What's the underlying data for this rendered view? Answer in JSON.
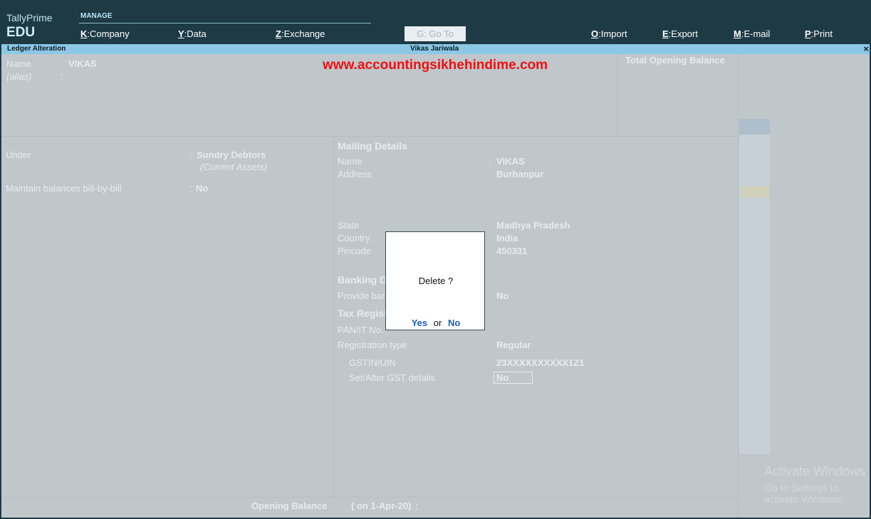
{
  "app": {
    "name": "TallyPrime",
    "edition": "EDU"
  },
  "menu": {
    "section_label": "MANAGE",
    "company": {
      "key": "K",
      "label": ":Company"
    },
    "data": {
      "key": "Y",
      "label": ":Data"
    },
    "exchange": {
      "key": "Z",
      "label": ":Exchange"
    },
    "goto": "G: Go To",
    "import": {
      "key": "O",
      "label": ":Import"
    },
    "export": {
      "key": "E",
      "label": ":Export"
    },
    "email": {
      "key": "M",
      "label": ":E-mail"
    },
    "print": {
      "key": "P",
      "label": ":Print"
    }
  },
  "titlebar": {
    "screen": "Ledger Alteration",
    "company": "Vikas Jariwala",
    "close": "×"
  },
  "watermark_url": "www.accountingsikhehindime.com",
  "ledger": {
    "name_label": "Name",
    "name_value": "VIKAS",
    "alias_label": "(alias)",
    "total_opening_balance": "Total Opening Balance",
    "under_label": "Under",
    "under_value": "Sundry Debtors",
    "under_group": "(Current Assets)",
    "bill_label": "Maintain balances bill-by-bill",
    "bill_value": "No",
    "opening_balance_label": "Opening Balance",
    "opening_balance_date": "( on 1-Apr-20)",
    "colon": ":"
  },
  "mailing": {
    "heading": "Mailing Details",
    "name_label": "Name",
    "name_value": "VIKAS",
    "address_label": "Address",
    "address_value": "Burhanpur",
    "state_label": "State",
    "state_value": "Madhya Pradesh",
    "country_label": "Country",
    "country_value": "India",
    "pincode_label": "Pincode",
    "pincode_value": "450331"
  },
  "banking": {
    "heading": "Banking Do",
    "provide_label": "Provide ban",
    "provide_value": "No"
  },
  "tax": {
    "heading": "Tax Regist",
    "pan_label": "PAN/IT No.",
    "reg_type_label": "Registration type",
    "reg_type_value": "Regular",
    "gstin_label": "GSTIN/UIN",
    "gstin_value": "23XXXXXXXXXX1Z1",
    "gst_details_label": "Set/Alter GST details",
    "gst_details_value": "No"
  },
  "dialog": {
    "question": "Delete ?",
    "yes": "Yes",
    "or": "or",
    "no": "No"
  },
  "windows_watermark": {
    "line1": "Activate Windows",
    "line2": "Go to Settings to activate Windows."
  }
}
